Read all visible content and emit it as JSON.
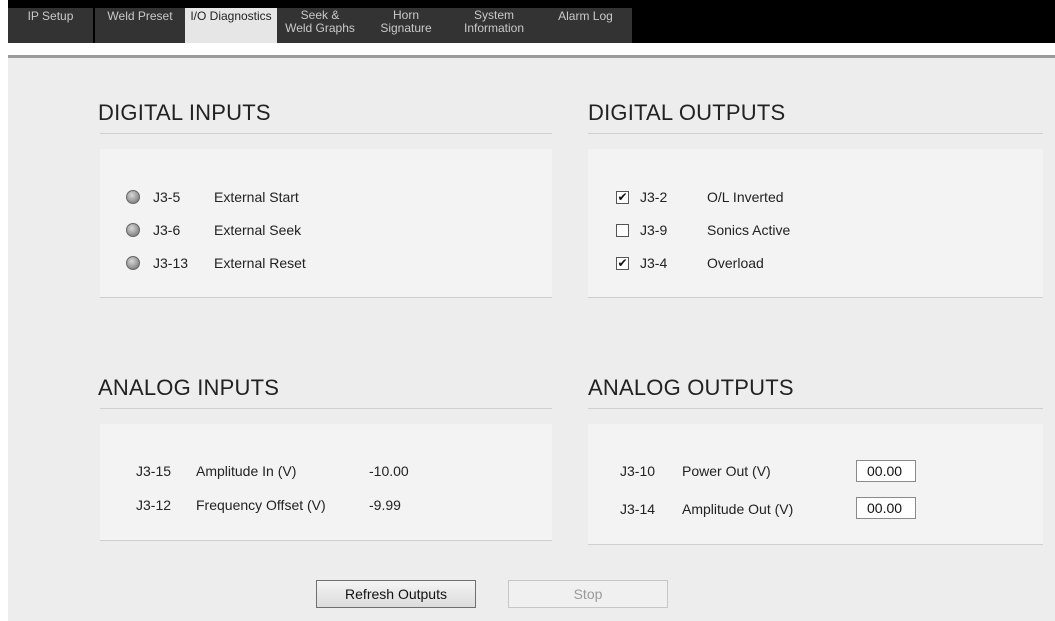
{
  "tabs": [
    {
      "lines": [
        "IP Setup"
      ]
    },
    {
      "lines": [
        "Weld Preset"
      ]
    },
    {
      "lines": [
        "I/O Diagnostics"
      ]
    },
    {
      "lines": [
        "Seek &",
        "Weld Graphs"
      ]
    },
    {
      "lines": [
        "Horn",
        "Signature"
      ]
    },
    {
      "lines": [
        "System",
        "Information"
      ]
    },
    {
      "lines": [
        "Alarm Log"
      ]
    }
  ],
  "active_tab": "I/O Diagnostics",
  "digital_inputs": {
    "title": "DIGITAL INPUTS",
    "rows": [
      {
        "pin": "J3-5",
        "label": "External Start"
      },
      {
        "pin": "J3-6",
        "label": "External Seek"
      },
      {
        "pin": "J3-13",
        "label": "External Reset"
      }
    ]
  },
  "digital_outputs": {
    "title": "DIGITAL OUTPUTS",
    "rows": [
      {
        "pin": "J3-2",
        "label": "O/L Inverted",
        "checked": true,
        "mark": "✔"
      },
      {
        "pin": "J3-9",
        "label": "Sonics Active",
        "checked": false,
        "mark": ""
      },
      {
        "pin": "J3-4",
        "label": "Overload",
        "checked": true,
        "mark": "✔"
      }
    ]
  },
  "analog_inputs": {
    "title": "ANALOG INPUTS",
    "rows": [
      {
        "pin": "J3-15",
        "label": "Amplitude In (V)",
        "value": "-10.00"
      },
      {
        "pin": "J3-12",
        "label": "Frequency Offset (V)",
        "value": "-9.99"
      }
    ]
  },
  "analog_outputs": {
    "title": "ANALOG OUTPUTS",
    "rows": [
      {
        "pin": "J3-10",
        "label": "Power Out (V)",
        "value": "00.00"
      },
      {
        "pin": "J3-14",
        "label": "Amplitude Out (V)",
        "value": "00.00"
      }
    ]
  },
  "buttons": {
    "refresh_label": "Refresh Outputs",
    "stop_label": "Stop"
  },
  "colors": {
    "tab_bar": "#000000",
    "tab_inactive": "#333333",
    "tab_active": "#e6e6e6",
    "panel": "#ededed"
  }
}
